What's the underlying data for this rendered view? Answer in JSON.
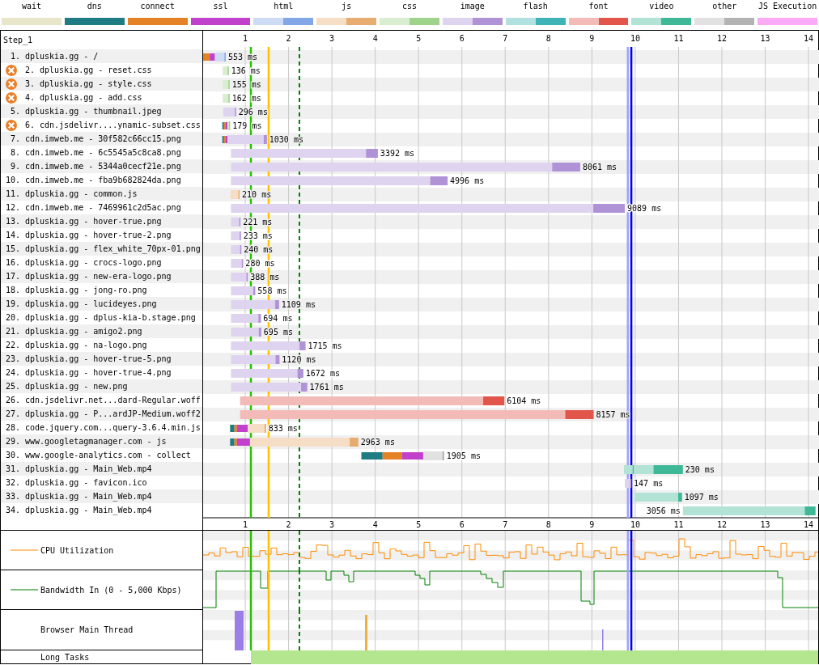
{
  "legend": [
    {
      "label": "wait",
      "kind": "solid",
      "color": "#e8e6c8"
    },
    {
      "label": "dns",
      "kind": "solid",
      "color": "#1f7c83"
    },
    {
      "label": "connect",
      "kind": "solid",
      "color": "#e58226"
    },
    {
      "label": "ssl",
      "kind": "solid",
      "color": "#c141cd"
    },
    {
      "label": "html",
      "kind": "split",
      "color": "#82a6e6"
    },
    {
      "label": "js",
      "kind": "split",
      "color": "#e7ac6f"
    },
    {
      "label": "css",
      "kind": "split",
      "color": "#9fd38b"
    },
    {
      "label": "image",
      "kind": "split",
      "color": "#b093d6"
    },
    {
      "label": "flash",
      "kind": "split",
      "color": "#3fb4b6"
    },
    {
      "label": "font",
      "kind": "split",
      "color": "#e2554a"
    },
    {
      "label": "video",
      "kind": "split",
      "color": "#3eb897"
    },
    {
      "label": "other",
      "kind": "split",
      "color": "#b3b3b3"
    },
    {
      "label": "JS Execution",
      "kind": "solid",
      "color": "#fbaaf6"
    }
  ],
  "waterfall": {
    "step": "Step_1",
    "requests": [
      {
        "number": "1.",
        "label": "dpluskia.gg - /",
        "time": "553 ms",
        "kind": "html",
        "error": false
      },
      {
        "number": "2.",
        "label": "dpluskia.gg - reset.css",
        "time": "136 ms",
        "kind": "css",
        "error": true
      },
      {
        "number": "3.",
        "label": "dpluskia.gg - style.css",
        "time": "155 ms",
        "kind": "css",
        "error": true
      },
      {
        "number": "4.",
        "label": "dpluskia.gg - add.css",
        "time": "162 ms",
        "kind": "css",
        "error": true
      },
      {
        "number": "5.",
        "label": "dpluskia.gg - thumbnail.jpeg",
        "time": "296 ms",
        "kind": "image",
        "error": false
      },
      {
        "number": "6.",
        "label": "cdn.jsdelivr....ynamic-subset.css",
        "time": "179 ms",
        "kind": "css",
        "error": true
      },
      {
        "number": "7.",
        "label": "cdn.imweb.me - 30f582c66cc15.png",
        "time": "1030 ms",
        "kind": "image",
        "error": false
      },
      {
        "number": "8.",
        "label": "cdn.imweb.me - 6c5545a5c8ca8.png",
        "time": "3392 ms",
        "kind": "image",
        "error": false
      },
      {
        "number": "9.",
        "label": "cdn.imweb.me - 5344a0cecf21e.png",
        "time": "8061 ms",
        "kind": "image",
        "error": false
      },
      {
        "number": "10.",
        "label": "cdn.imweb.me - fba9b682824da.png",
        "time": "4996 ms",
        "kind": "image",
        "error": false
      },
      {
        "number": "11.",
        "label": "dpluskia.gg - common.js",
        "time": "210 ms",
        "kind": "js",
        "error": false
      },
      {
        "number": "12.",
        "label": "cdn.imweb.me - 7469961c2d5ac.png",
        "time": "9089 ms",
        "kind": "image",
        "error": false
      },
      {
        "number": "13.",
        "label": "dpluskia.gg - hover-true.png",
        "time": "221 ms",
        "kind": "image",
        "error": false
      },
      {
        "number": "14.",
        "label": "dpluskia.gg - hover-true-2.png",
        "time": "233 ms",
        "kind": "image",
        "error": false
      },
      {
        "number": "15.",
        "label": "dpluskia.gg - flex_white_70px-01.png",
        "time": "240 ms",
        "kind": "image",
        "error": false
      },
      {
        "number": "16.",
        "label": "dpluskia.gg - crocs-logo.png",
        "time": "280 ms",
        "kind": "image",
        "error": false
      },
      {
        "number": "17.",
        "label": "dpluskia.gg - new-era-logo.png",
        "time": "388 ms",
        "kind": "image",
        "error": false
      },
      {
        "number": "18.",
        "label": "dpluskia.gg - jong-ro.png",
        "time": "558 ms",
        "kind": "image",
        "error": false
      },
      {
        "number": "19.",
        "label": "dpluskia.gg - lucideyes.png",
        "time": "1109 ms",
        "kind": "image",
        "error": false
      },
      {
        "number": "20.",
        "label": "dpluskia.gg - dplus-kia-b.stage.png",
        "time": "694 ms",
        "kind": "image",
        "error": false
      },
      {
        "number": "21.",
        "label": "dpluskia.gg - amigo2.png",
        "time": "695 ms",
        "kind": "image",
        "error": false
      },
      {
        "number": "22.",
        "label": "dpluskia.gg - na-logo.png",
        "time": "1715 ms",
        "kind": "image",
        "error": false
      },
      {
        "number": "23.",
        "label": "dpluskia.gg - hover-true-5.png",
        "time": "1120 ms",
        "kind": "image",
        "error": false
      },
      {
        "number": "24.",
        "label": "dpluskia.gg - hover-true-4.png",
        "time": "1672 ms",
        "kind": "image",
        "error": false
      },
      {
        "number": "25.",
        "label": "dpluskia.gg - new.png",
        "time": "1761 ms",
        "kind": "image",
        "error": false
      },
      {
        "number": "26.",
        "label": "cdn.jsdelivr.net...dard-Regular.woff",
        "time": "6104 ms",
        "kind": "font",
        "error": false
      },
      {
        "number": "27.",
        "label": "dpluskia.gg - P...ardJP-Medium.woff2",
        "time": "8157 ms",
        "kind": "font",
        "error": false
      },
      {
        "number": "28.",
        "label": "code.jquery.com...query-3.6.4.min.js",
        "time": "833 ms",
        "kind": "js",
        "error": false
      },
      {
        "number": "29.",
        "label": "www.googletagmanager.com - js",
        "time": "2963 ms",
        "kind": "js",
        "error": false
      },
      {
        "number": "30.",
        "label": "www.google-analytics.com - collect",
        "time": "1905 ms",
        "kind": "other",
        "error": false
      },
      {
        "number": "31.",
        "label": "dpluskia.gg - Main_Web.mp4",
        "time": "230 ms",
        "kind": "video",
        "error": false
      },
      {
        "number": "32.",
        "label": "dpluskia.gg - favicon.ico",
        "time": "147 ms",
        "kind": "image",
        "error": false
      },
      {
        "number": "33.",
        "label": "dpluskia.gg - Main_Web.mp4",
        "time": "1097 ms",
        "kind": "video",
        "error": false
      },
      {
        "number": "34.",
        "label": "dpluskia.gg - Main_Web.mp4",
        "time": "3056 ms",
        "kind": "video",
        "error": false
      }
    ],
    "top_ticks": [
      "1",
      "2",
      "3",
      "4",
      "5",
      "6",
      "7",
      "8",
      "9",
      "10",
      "11",
      "12",
      "13",
      "14"
    ],
    "bottom_ticks": [
      "1",
      "2",
      "3",
      "4",
      "5",
      "6",
      "7",
      "8",
      "9",
      "10",
      "11",
      "12",
      "13",
      "14"
    ]
  },
  "panels": [
    {
      "label": "CPU Utilization",
      "kind": "cpu"
    },
    {
      "label": "Bandwidth In (0 - 5,000 Kbps)",
      "kind": "bandwidth"
    },
    {
      "label": "Browser Main Thread",
      "kind": "main_thread"
    },
    {
      "label": "Long Tasks",
      "kind": "long_tasks"
    }
  ]
}
